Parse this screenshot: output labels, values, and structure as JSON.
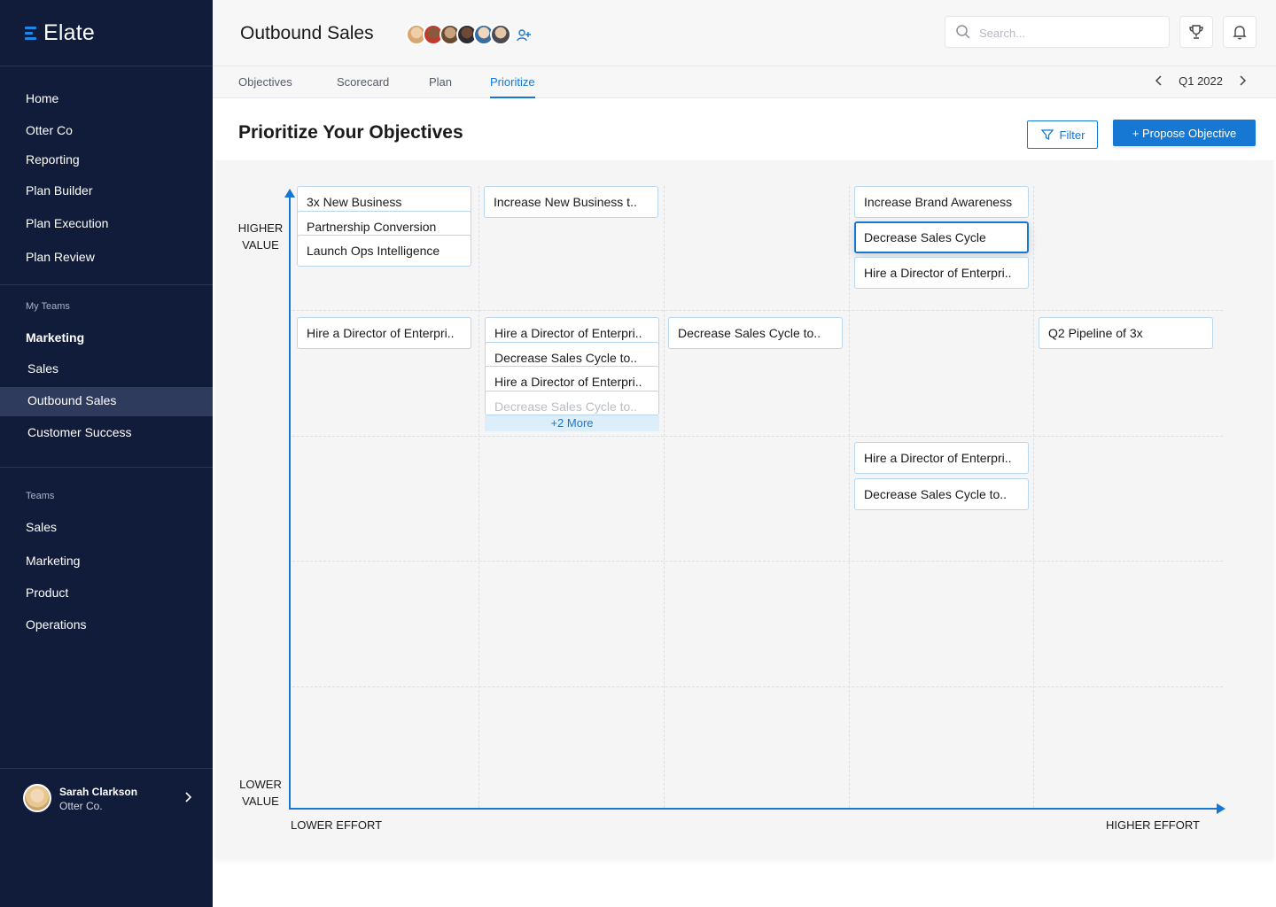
{
  "brand": {
    "name": "Elate",
    "accent": "#1e88e5"
  },
  "sidebar": {
    "nav": [
      "Home",
      "Otter Co",
      "Reporting",
      "Plan Builder",
      "Plan Execution",
      "Plan Review"
    ],
    "my_teams_heading": "My Teams",
    "my_teams": [
      "Marketing",
      "Sales",
      "Outbound Sales",
      "Customer Success"
    ],
    "active_team": "Outbound Sales",
    "teams_heading": "Teams",
    "teams": [
      "Sales",
      "Marketing",
      "Product",
      "Operations"
    ],
    "user": {
      "name": "Sarah Clarkson",
      "org": "Otter Co."
    }
  },
  "header": {
    "title": "Outbound Sales",
    "search_placeholder": "Search...",
    "icons": [
      "trophy-icon",
      "bell-icon",
      "add-member-icon",
      "search-icon"
    ]
  },
  "tabs": {
    "items": [
      "Objectives",
      "Scorecard",
      "Plan",
      "Prioritize"
    ],
    "active": "Prioritize",
    "period": "Q1 2022"
  },
  "content": {
    "title": "Prioritize Your Objectives",
    "filter_label": "Filter",
    "propose_label": "+ Propose Objective"
  },
  "matrix": {
    "y_high": [
      "HIGHER",
      "VALUE"
    ],
    "y_low": [
      "LOWER",
      "VALUE"
    ],
    "x_low": "LOWER EFFORT",
    "x_high": "HIGHER EFFORT",
    "more_label": "+2 More",
    "cards": [
      "3x New Business",
      "Partnership Conversion",
      "Launch Ops Intelligence",
      "Increase New Business t..",
      "Increase Brand Awareness",
      "Decrease Sales Cycle",
      "Hire a Director of Enterpri..",
      "Hire a Director of Enterpri..",
      "Hire a Director of Enterpri..",
      "Decrease Sales Cycle to..",
      "Hire a Director of Enterpri..",
      "Decrease Sales Cycle to..",
      "Decrease Sales Cycle to..",
      "Q2 Pipeline of 3x",
      "Hire a Director of Enterpri..",
      "Decrease Sales Cycle to.."
    ]
  },
  "colors": {
    "sidebar_bg": "#111c3a",
    "primary": "#1678d2",
    "card_border": "#b9d6ef"
  }
}
